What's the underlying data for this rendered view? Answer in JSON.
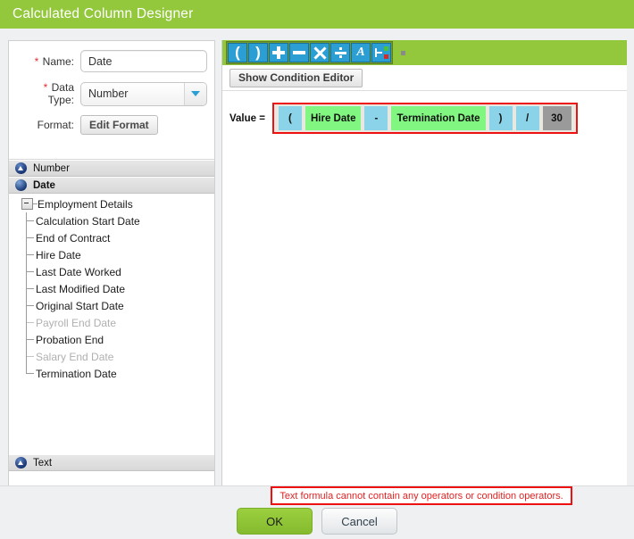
{
  "window": {
    "title": "Calculated Column Designer"
  },
  "form": {
    "name": {
      "label": "Name:",
      "required_marker": "*",
      "value": "Date"
    },
    "data_type": {
      "label_line1": "Data",
      "label_line2": "Type:",
      "required_marker": "*",
      "value": "Number",
      "options": [
        "Number",
        "Date",
        "Text"
      ],
      "arrow_icon": "chevron-down-icon"
    },
    "format": {
      "label": "Format:",
      "button_label": "Edit Format"
    }
  },
  "accordion": {
    "number_section": {
      "label": "Number",
      "icon": "triangle-up-circle-icon"
    },
    "date_section": {
      "label": "Date",
      "icon": "sphere-icon"
    },
    "text_section": {
      "label": "Text",
      "icon": "triangle-up-circle-icon"
    }
  },
  "tree": {
    "root": {
      "label": "Employment Details",
      "expander_icon": "minus-box-icon",
      "expanded": true
    },
    "items": [
      {
        "label": "Calculation Start Date",
        "disabled": false
      },
      {
        "label": "End of Contract",
        "disabled": false
      },
      {
        "label": "Hire Date",
        "disabled": false
      },
      {
        "label": "Last Date Worked",
        "disabled": false
      },
      {
        "label": "Last Modified Date",
        "disabled": false
      },
      {
        "label": "Original Start Date",
        "disabled": false
      },
      {
        "label": "Payroll End Date",
        "disabled": true
      },
      {
        "label": "Probation End",
        "disabled": false
      },
      {
        "label": "Salary End Date",
        "disabled": true
      },
      {
        "label": "Termination Date",
        "disabled": false
      }
    ]
  },
  "toolbar": {
    "buttons": [
      {
        "name": "open-paren-icon",
        "label": "("
      },
      {
        "name": "close-paren-icon",
        "label": ")"
      },
      {
        "name": "plus-icon",
        "label": "+"
      },
      {
        "name": "minus-icon",
        "label": "-"
      },
      {
        "name": "multiply-icon",
        "label": "×"
      },
      {
        "name": "divide-icon",
        "label": "÷"
      },
      {
        "name": "text-italic-a-icon",
        "label": "A"
      },
      {
        "name": "condition-node-icon",
        "label": ""
      }
    ],
    "overflow_icon": "overflow-dot-icon"
  },
  "condition_editor": {
    "button_label": "Show Condition Editor"
  },
  "formula": {
    "label": "Value =",
    "tokens": [
      {
        "text": "(",
        "kind": "op"
      },
      {
        "text": "Hire Date",
        "kind": "field"
      },
      {
        "text": "-",
        "kind": "op"
      },
      {
        "text": "Termination Date",
        "kind": "field"
      },
      {
        "text": ")",
        "kind": "op"
      },
      {
        "text": "/",
        "kind": "op"
      },
      {
        "text": "30",
        "kind": "num-sel"
      }
    ],
    "highlight_color": "#ee1111"
  },
  "footer": {
    "error_message": "Text formula cannot contain any operators or condition operators.",
    "ok_label": "OK",
    "cancel_label": "Cancel"
  },
  "colors": {
    "brand_green": "#93c83d",
    "operator_token": "#8ad3e8",
    "field_token": "#81f781",
    "selected_token": "#9a9a9a",
    "error_red": "#ee1111",
    "toolbar_icon_blue": "#2b9fd4"
  }
}
